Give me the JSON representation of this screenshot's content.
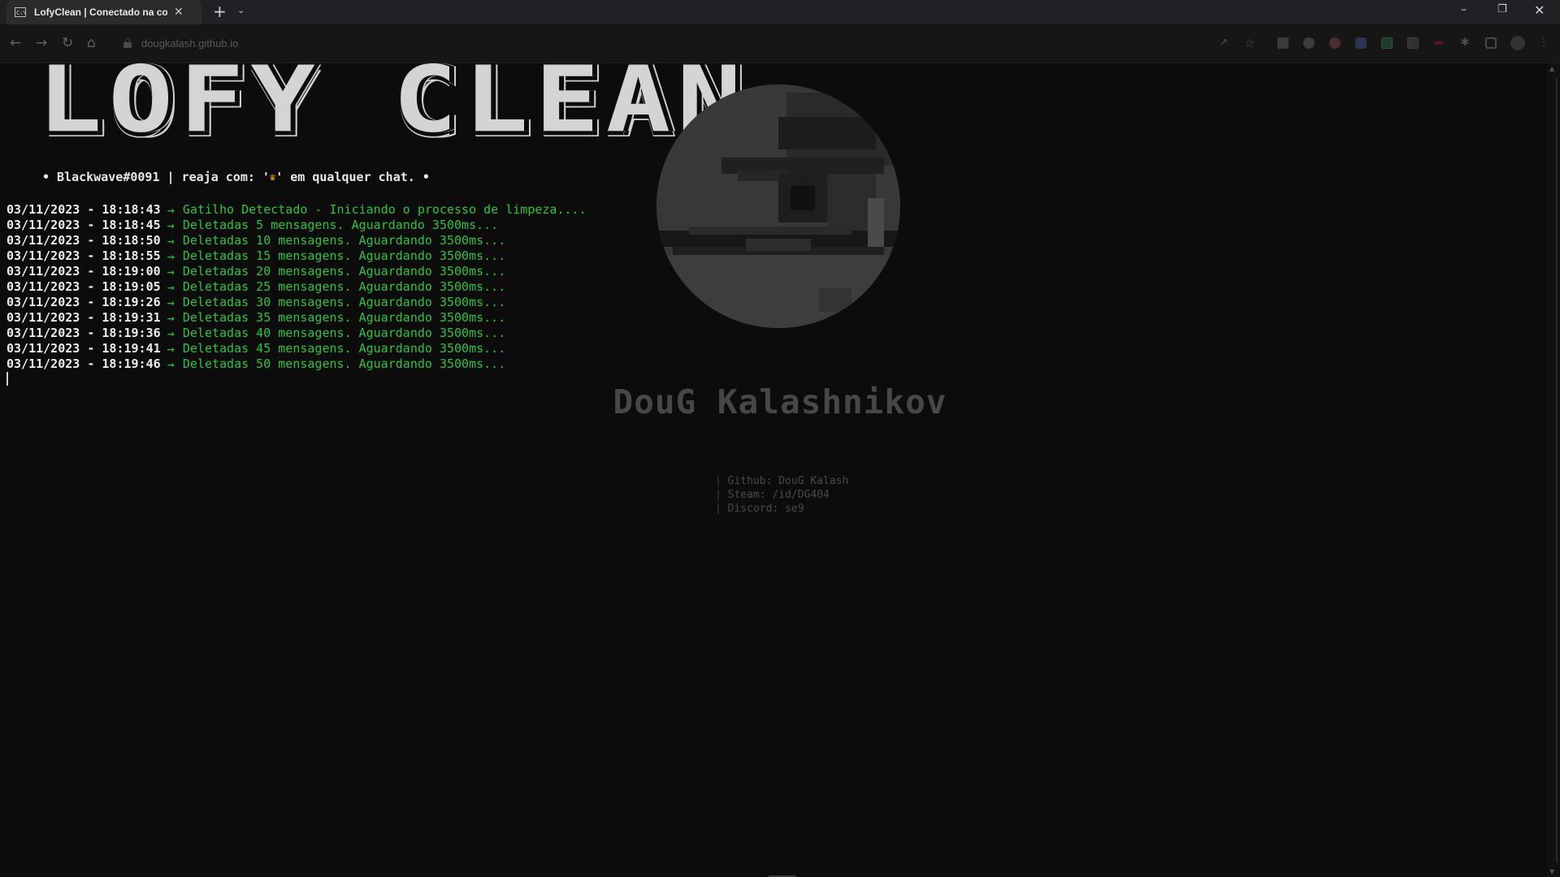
{
  "browser": {
    "tab_title": "LofyClean | Conectado na cont",
    "tab_favicon_text": "C:\\",
    "new_tab_label": "+",
    "tab_list_label": "⌄",
    "url": "dougkalash.github.io",
    "window_controls": {
      "minimize": "–",
      "restore": "❐",
      "close": "✕"
    },
    "nav": {
      "back": "←",
      "forward": "→",
      "reload": "↻",
      "home": "⌂"
    },
    "toolbar_icons": [
      "share-icon",
      "star-icon",
      "database-extension-icon",
      "circle-extension-icon",
      "globe-extension-icon",
      "discord-extension-icon",
      "terminal-extension-icon",
      "gamepad-extension-icon",
      "red-extension-icon",
      "puzzle-extensions-icon",
      "side-panel-icon",
      "profile-icon",
      "menu-icon"
    ],
    "toolbar_glyphs": {
      "share": "↗",
      "star": "☆",
      "puzzle": "✱",
      "menu": "⋮",
      "red_ext": "ᴜᴏ"
    }
  },
  "page": {
    "logo": "LOFY CLEAN",
    "subtitle_prefix": "• Blackwave#0091 | reaja com: '",
    "subtitle_crown": "♛",
    "subtitle_suffix": "' em qualquer chat. •",
    "log": [
      {
        "ts": "03/11/2023 - 18:18:43",
        "arrow": "→",
        "msg": "Gatilho Detectado - Iniciando o processo de limpeza...."
      },
      {
        "ts": "03/11/2023 - 18:18:45",
        "arrow": "→",
        "msg": "Deletadas 5 mensagens. Aguardando 3500ms..."
      },
      {
        "ts": "03/11/2023 - 18:18:50",
        "arrow": "→",
        "msg": "Deletadas 10 mensagens. Aguardando 3500ms..."
      },
      {
        "ts": "03/11/2023 - 18:18:55",
        "arrow": "→",
        "msg": "Deletadas 15 mensagens. Aguardando 3500ms..."
      },
      {
        "ts": "03/11/2023 - 18:19:00",
        "arrow": "→",
        "msg": "Deletadas 20 mensagens. Aguardando 3500ms..."
      },
      {
        "ts": "03/11/2023 - 18:19:05",
        "arrow": "→",
        "msg": "Deletadas 25 mensagens. Aguardando 3500ms..."
      },
      {
        "ts": "03/11/2023 - 18:19:26",
        "arrow": "→",
        "msg": "Deletadas 30 mensagens. Aguardando 3500ms..."
      },
      {
        "ts": "03/11/2023 - 18:19:31",
        "arrow": "→",
        "msg": "Deletadas 35 mensagens. Aguardando 3500ms..."
      },
      {
        "ts": "03/11/2023 - 18:19:36",
        "arrow": "→",
        "msg": "Deletadas 40 mensagens. Aguardando 3500ms..."
      },
      {
        "ts": "03/11/2023 - 18:19:41",
        "arrow": "→",
        "msg": "Deletadas 45 mensagens. Aguardando 3500ms..."
      },
      {
        "ts": "03/11/2023 - 18:19:46",
        "arrow": "→",
        "msg": "Deletadas 50 mensagens. Aguardando 3500ms..."
      }
    ],
    "profile": {
      "name": "DouG Kalashnikov",
      "links": [
        {
          "sep": "| ",
          "text": "Github: DouG Kalash"
        },
        {
          "sep": "| ",
          "text": "Steam: /id/DG404"
        },
        {
          "sep": "| ",
          "text": "Discord: se9"
        }
      ]
    }
  },
  "colors": {
    "background": "#0c0c0c",
    "log_timestamp": "#ececec",
    "log_message": "#2cc33b",
    "crown": "#f5b400",
    "profile_text": "#474747"
  }
}
